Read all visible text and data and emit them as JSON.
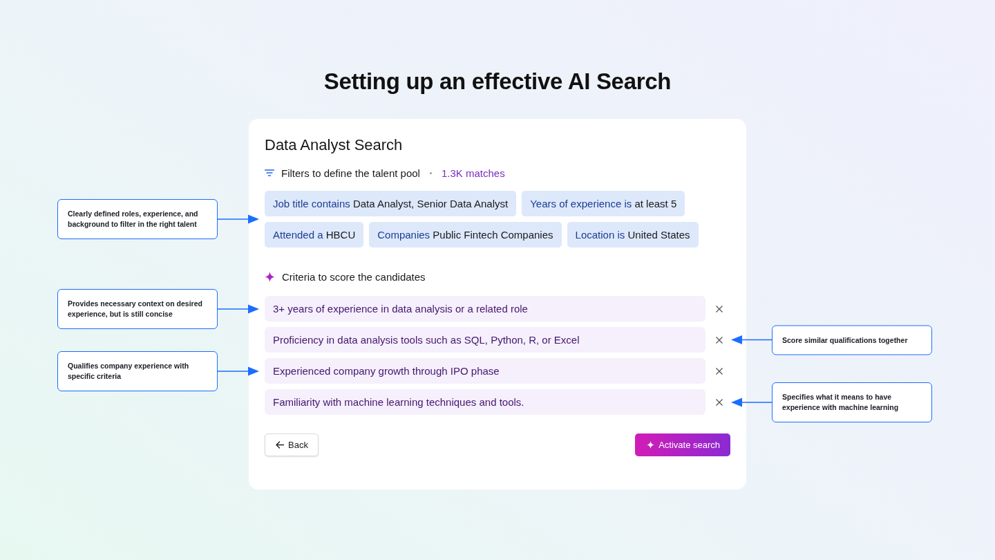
{
  "page": {
    "title": "Setting up an effective AI Search"
  },
  "search": {
    "title": "Data Analyst Search",
    "filters": {
      "label": "Filters to define the talent pool",
      "match_count": "1.3K matches",
      "note": {
        "text": "Clearly defined roles, experience, and background to filter in the right talent",
        "kind": "left"
      },
      "chips": [
        {
          "field": "Job title contains",
          "value": "Data Analyst, Senior Data Analyst"
        },
        {
          "field": "Years of experience is",
          "value": "at least 5"
        },
        {
          "field": "Attended a",
          "value": "HBCU"
        },
        {
          "field": "Companies",
          "value": "Public Fintech Companies"
        },
        {
          "field": "Location is",
          "value": "United States"
        }
      ]
    },
    "criteria": {
      "label": "Criteria to score the candidates",
      "items": [
        {
          "text": "3+ years of experience in data analysis or a related role",
          "note": {
            "text": "Provides necessary context on desired experience, but is still concise",
            "kind": "left"
          }
        },
        {
          "text": "Proficiency in data analysis tools such as SQL, Python, R, or Excel",
          "note": {
            "text": "Score similar qualifications together",
            "kind": "right"
          }
        },
        {
          "text": "Experienced company growth through IPO phase",
          "note": {
            "text": "Qualifies company experience with specific criteria",
            "kind": "left"
          }
        },
        {
          "text": "Familiarity with machine learning techniques and tools.",
          "note": {
            "text": "Specifies what it means to have experience with machine learning",
            "kind": "right"
          }
        }
      ]
    },
    "buttons": [
      {
        "kind": "back",
        "label": "Back"
      },
      {
        "kind": "primary",
        "label": "Activate search"
      }
    ]
  }
}
